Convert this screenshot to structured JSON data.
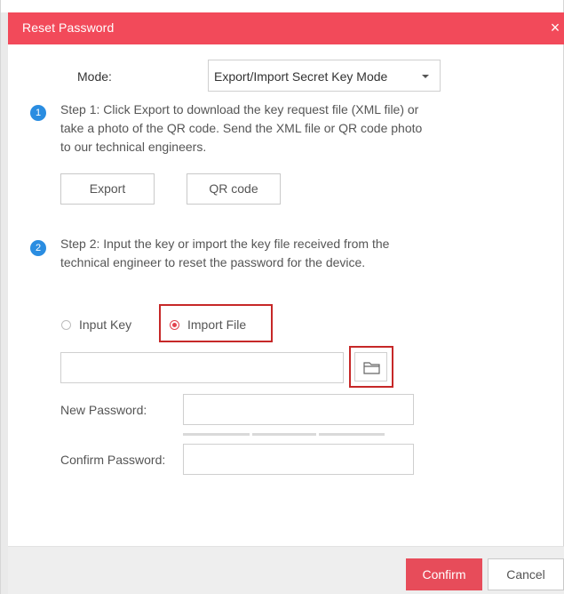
{
  "dialog": {
    "title": "Reset Password",
    "close_glyph": "×"
  },
  "mode": {
    "label": "Mode:",
    "selected": "Export/Import Secret Key Mode"
  },
  "step1": {
    "badge": "1",
    "text": "Step 1: Click Export to download the key request file (XML file) or take a photo of the QR code. Send the XML file or QR code photo to our technical engineers.",
    "export_label": "Export",
    "qrcode_label": "QR code"
  },
  "step2": {
    "badge": "2",
    "text": "Step 2: Input the key or import the key file received from the technical engineer to reset the password for the device.",
    "radio_input_key": "Input Key",
    "radio_import_file": "Import File",
    "selected_option": "Import File"
  },
  "file_path": {
    "value": "",
    "placeholder": ""
  },
  "new_password": {
    "label": "New Password:",
    "value": ""
  },
  "confirm_password": {
    "label": "Confirm Password:",
    "value": ""
  },
  "footer": {
    "confirm_label": "Confirm",
    "cancel_label": "Cancel"
  },
  "icons": {
    "folder": "folder-icon",
    "close": "close-icon",
    "dropdown": "chevron-down-icon"
  },
  "colors": {
    "title_bar": "#f24a5a",
    "confirm": "#e74c5a",
    "step_badge": "#2a8de1",
    "highlight": "#c62828"
  }
}
